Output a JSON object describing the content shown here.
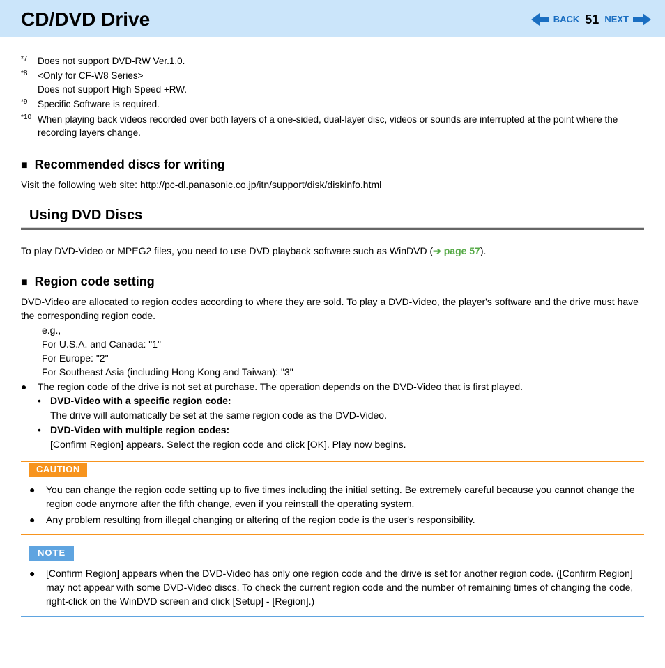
{
  "header": {
    "title": "CD/DVD Drive",
    "back": "BACK",
    "page": "51",
    "next": "NEXT"
  },
  "footnotes": {
    "f7_num": "*7",
    "f7_text": "Does not support DVD-RW Ver.1.0.",
    "f8_num": "*8",
    "f8_text_a": "<Only for CF-W8 Series>",
    "f8_text_b": "Does not support High Speed +RW.",
    "f9_num": "*9",
    "f9_text": "Specific Software is required.",
    "f10_num": "*10",
    "f10_text": "When playing back videos recorded over both layers of a one-sided, dual-layer disc, videos or sounds are interrupted at the point where the recording layers change."
  },
  "rec": {
    "heading": "Recommended discs for writing",
    "text": "Visit the following web site: http://pc-dl.panasonic.co.jp/itn/support/disk/diskinfo.html"
  },
  "using": {
    "title": "Using DVD Discs",
    "intro_a": "To play DVD-Video or MPEG2 files, you need to use DVD playback software such as WinDVD (",
    "intro_link": " page 57",
    "intro_b": ")."
  },
  "region": {
    "heading": "Region code setting",
    "p1": "DVD-Video are allocated to region codes according to where they are sold. To play a DVD-Video, the player's software and the drive must have the corresponding region code.",
    "eg": "e.g.,",
    "eg1": "For U.S.A. and Canada: \"1\"",
    "eg2": "For Europe: \"2\"",
    "eg3": "For Southeast Asia (including Hong Kong and Taiwan): \"3\"",
    "b1": "The region code of the drive is not set at purchase. The operation depends on the DVD-Video that is first played.",
    "sb1_title": "DVD-Video with a specific region code:",
    "sb1_text": "The drive will automatically be set at the same region code as the DVD-Video.",
    "sb2_title": "DVD-Video with multiple region codes:",
    "sb2_text": "[Confirm Region] appears. Select the region code and click [OK]. Play now begins."
  },
  "caution": {
    "label": "CAUTION",
    "item1": "You can change the region code setting up to five times including the initial setting. Be extremely careful because you cannot change the region code anymore after the fifth change, even if you reinstall the operating system.",
    "item2": "Any problem resulting from illegal changing or altering of the region code is the user's responsibility."
  },
  "note": {
    "label": "NOTE",
    "item1": "[Confirm Region] appears when the DVD-Video has only one region code and the drive is set for another region code. ([Confirm Region] may not appear with some DVD-Video discs. To check the current region code and the number of remaining times of changing the code, right-click on the WinDVD screen and click [Setup] - [Region].)"
  }
}
